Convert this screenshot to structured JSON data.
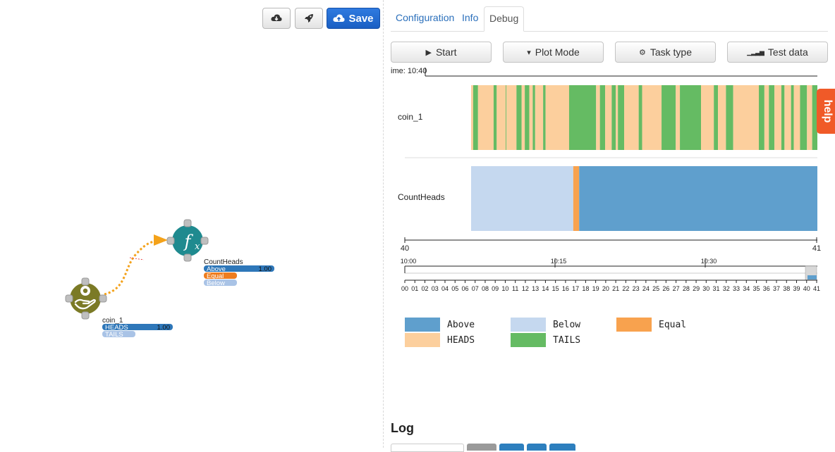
{
  "toolbar": {
    "download_icon": "cloud-download-icon",
    "deploy_icon": "rocket-icon",
    "save_label": "Save",
    "save_icon": "cloud-upload-icon",
    "save_color": "#1f6dd6"
  },
  "graph": {
    "count_node": {
      "title": "CountHeads",
      "icon": "function-fx-icon",
      "color": "#1f8a8f",
      "ports": [
        {
          "label": "Above",
          "value": "1.00",
          "color": "#2e77b9"
        },
        {
          "label": "Equal",
          "value": "",
          "color": "#ee7d1f"
        },
        {
          "label": "Below",
          "value": "",
          "color": "#a9c3e6"
        }
      ]
    },
    "coin_node": {
      "title": "coin_1",
      "icon": "hand-coin-icon",
      "color": "#7b7a26",
      "ports": [
        {
          "label": "HEADS",
          "value": "1.00",
          "color": "#2e77b9"
        },
        {
          "label": "TAILS",
          "value": "",
          "color": "#a9c3e6"
        }
      ]
    },
    "edge_color": "#f4a21a"
  },
  "tabs": [
    {
      "label": "Configuration",
      "active": false
    },
    {
      "label": "Info",
      "active": false
    },
    {
      "label": "Debug",
      "active": true
    }
  ],
  "debug_buttons": [
    {
      "label": "Start",
      "icon": "play-icon",
      "glyph": "▶"
    },
    {
      "label": "Plot Mode",
      "icon": "caret-down-icon",
      "glyph": "▾"
    },
    {
      "label": "Task type",
      "icon": "gears-icon",
      "glyph": "⚙"
    },
    {
      "label": "Test data",
      "icon": "signal-bars-icon",
      "glyph": "▁▂▃▅"
    }
  ],
  "timeline": {
    "time_label": "ime: 10:40",
    "tracks": [
      {
        "name": "coin_1",
        "states": [
          "HEADS",
          "TAILS"
        ]
      },
      {
        "name": "CountHeads",
        "states": [
          "Above",
          "Below",
          "Equal"
        ]
      }
    ],
    "range_start": "40",
    "range_end": "41",
    "overview_times": [
      "10:00",
      "10:15",
      "10:30"
    ],
    "minute_ticks": [
      "00",
      "01",
      "02",
      "03",
      "04",
      "05",
      "06",
      "07",
      "08",
      "09",
      "10",
      "11",
      "12",
      "13",
      "14",
      "15",
      "16",
      "17",
      "18",
      "19",
      "20",
      "21",
      "22",
      "23",
      "24",
      "25",
      "26",
      "27",
      "28",
      "29",
      "30",
      "31",
      "32",
      "33",
      "34",
      "35",
      "36",
      "37",
      "38",
      "39",
      "40",
      "41"
    ]
  },
  "chart_data": {
    "type": "heatmap",
    "title": "",
    "x_range": [
      40,
      41
    ],
    "series": [
      {
        "name": "coin_1",
        "segments": [
          {
            "state": "HEADS",
            "from": 40.0,
            "to": 40.006
          },
          {
            "state": "TAILS",
            "from": 40.006,
            "to": 40.02
          },
          {
            "state": "HEADS",
            "from": 40.02,
            "to": 40.065
          },
          {
            "state": "TAILS",
            "from": 40.065,
            "to": 40.074
          },
          {
            "state": "HEADS",
            "from": 40.074,
            "to": 40.1
          },
          {
            "state": "TAILS",
            "from": 40.1,
            "to": 40.102
          },
          {
            "state": "HEADS",
            "from": 40.102,
            "to": 40.131
          },
          {
            "state": "TAILS",
            "from": 40.131,
            "to": 40.146
          },
          {
            "state": "HEADS",
            "from": 40.146,
            "to": 40.155
          },
          {
            "state": "TAILS",
            "from": 40.155,
            "to": 40.168
          },
          {
            "state": "HEADS",
            "from": 40.168,
            "to": 40.178
          },
          {
            "state": "TAILS",
            "from": 40.178,
            "to": 40.185
          },
          {
            "state": "HEADS",
            "from": 40.185,
            "to": 40.208
          },
          {
            "state": "TAILS",
            "from": 40.208,
            "to": 40.215
          },
          {
            "state": "HEADS",
            "from": 40.215,
            "to": 40.283
          },
          {
            "state": "TAILS",
            "from": 40.283,
            "to": 40.361
          },
          {
            "state": "HEADS",
            "from": 40.361,
            "to": 40.372
          },
          {
            "state": "TAILS",
            "from": 40.372,
            "to": 40.387
          },
          {
            "state": "HEADS",
            "from": 40.387,
            "to": 40.406
          },
          {
            "state": "TAILS",
            "from": 40.406,
            "to": 40.418
          },
          {
            "state": "HEADS",
            "from": 40.418,
            "to": 40.424
          },
          {
            "state": "TAILS",
            "from": 40.424,
            "to": 40.442
          },
          {
            "state": "HEADS",
            "from": 40.442,
            "to": 40.484
          },
          {
            "state": "TAILS",
            "from": 40.484,
            "to": 40.494
          },
          {
            "state": "HEADS",
            "from": 40.494,
            "to": 40.55
          },
          {
            "state": "TAILS",
            "from": 40.55,
            "to": 40.591
          },
          {
            "state": "HEADS",
            "from": 40.591,
            "to": 40.603
          },
          {
            "state": "TAILS",
            "from": 40.603,
            "to": 40.664
          },
          {
            "state": "HEADS",
            "from": 40.664,
            "to": 40.701
          },
          {
            "state": "TAILS",
            "from": 40.701,
            "to": 40.713
          },
          {
            "state": "HEADS",
            "from": 40.713,
            "to": 40.736
          },
          {
            "state": "TAILS",
            "from": 40.736,
            "to": 40.757
          },
          {
            "state": "HEADS",
            "from": 40.757,
            "to": 40.831
          },
          {
            "state": "TAILS",
            "from": 40.831,
            "to": 40.847
          },
          {
            "state": "HEADS",
            "from": 40.847,
            "to": 40.86
          },
          {
            "state": "TAILS",
            "from": 40.86,
            "to": 40.876
          },
          {
            "state": "HEADS",
            "from": 40.876,
            "to": 40.896
          },
          {
            "state": "TAILS",
            "from": 40.896,
            "to": 40.905
          },
          {
            "state": "HEADS",
            "from": 40.905,
            "to": 40.924
          },
          {
            "state": "TAILS",
            "from": 40.924,
            "to": 40.932
          },
          {
            "state": "HEADS",
            "from": 40.932,
            "to": 40.95
          },
          {
            "state": "TAILS",
            "from": 40.95,
            "to": 40.97
          },
          {
            "state": "HEADS",
            "from": 40.97,
            "to": 40.985
          },
          {
            "state": "TAILS",
            "from": 40.985,
            "to": 41.0
          }
        ]
      },
      {
        "name": "CountHeads",
        "segments": [
          {
            "state": "Below",
            "from": 40.0,
            "to": 40.295
          },
          {
            "state": "Equal",
            "from": 40.295,
            "to": 40.312
          },
          {
            "state": "Above",
            "from": 40.312,
            "to": 41.0
          }
        ]
      }
    ],
    "legend": [
      {
        "label": "Above",
        "color": "#5f9fcd"
      },
      {
        "label": "Below",
        "color": "#c5d8ef"
      },
      {
        "label": "Equal",
        "color": "#f8a24e"
      },
      {
        "label": "HEADS",
        "color": "#fccf9d"
      },
      {
        "label": "TAILS",
        "color": "#65bb63"
      }
    ]
  },
  "log": {
    "heading": "Log",
    "button_colors": [
      "#ffffff",
      "#9a9a9a",
      "#2d7fbe",
      "#2d7fbe",
      "#2d7fbe"
    ]
  },
  "help": {
    "label": "help",
    "color": "#f05a28"
  }
}
